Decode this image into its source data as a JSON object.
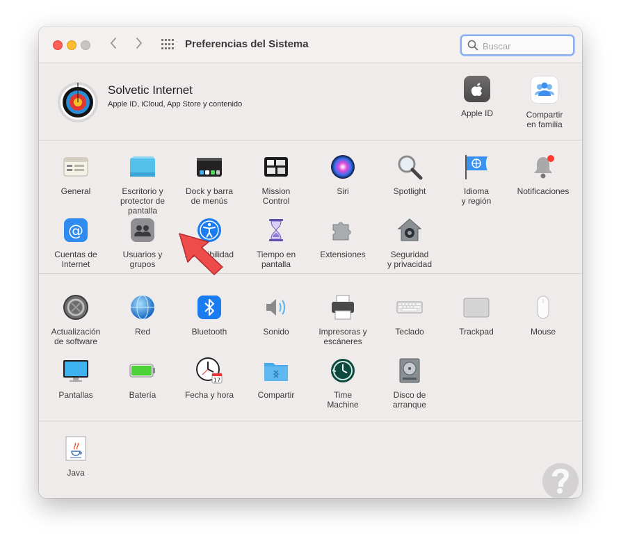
{
  "window": {
    "title": "Preferencias del Sistema"
  },
  "search": {
    "placeholder": "Buscar",
    "value": ""
  },
  "account": {
    "name": "Solvetic Internet",
    "subtitle": "Apple ID, iCloud, App Store y contenido",
    "items": [
      {
        "label": "Apple ID",
        "icon": "apple-id-icon"
      },
      {
        "label": "Compartir\nen familia",
        "icon": "family-sharing-icon"
      }
    ]
  },
  "row1": [
    {
      "label": "General",
      "icon": "general-icon"
    },
    {
      "label": "Escritorio y\nprotector de pantalla",
      "icon": "desktop-screensaver-icon"
    },
    {
      "label": "Dock y barra\nde menús",
      "icon": "dock-menubar-icon"
    },
    {
      "label": "Mission\nControl",
      "icon": "mission-control-icon"
    },
    {
      "label": "Siri",
      "icon": "siri-icon"
    },
    {
      "label": "Spotlight",
      "icon": "spotlight-icon"
    },
    {
      "label": "Idioma\ny región",
      "icon": "language-region-icon"
    },
    {
      "label": "Notificaciones",
      "icon": "notifications-icon"
    }
  ],
  "row2": [
    {
      "label": "Cuentas de\nInternet",
      "icon": "internet-accounts-icon"
    },
    {
      "label": "Usuarios y\ngrupos",
      "icon": "users-groups-icon"
    },
    {
      "label": "Accesibilidad",
      "icon": "accessibility-icon"
    },
    {
      "label": "Tiempo en\npantalla",
      "icon": "screen-time-icon"
    },
    {
      "label": "Extensiones",
      "icon": "extensions-icon"
    },
    {
      "label": "Seguridad\ny privacidad",
      "icon": "security-privacy-icon"
    }
  ],
  "row3": [
    {
      "label": "Actualización\nde software",
      "icon": "software-update-icon"
    },
    {
      "label": "Red",
      "icon": "network-icon"
    },
    {
      "label": "Bluetooth",
      "icon": "bluetooth-icon"
    },
    {
      "label": "Sonido",
      "icon": "sound-icon"
    },
    {
      "label": "Impresoras y\nescáneres",
      "icon": "printers-scanners-icon"
    },
    {
      "label": "Teclado",
      "icon": "keyboard-icon"
    },
    {
      "label": "Trackpad",
      "icon": "trackpad-icon"
    },
    {
      "label": "Mouse",
      "icon": "mouse-icon"
    }
  ],
  "row4": [
    {
      "label": "Pantallas",
      "icon": "displays-icon"
    },
    {
      "label": "Batería",
      "icon": "battery-icon"
    },
    {
      "label": "Fecha y hora",
      "icon": "date-time-icon",
      "calendar_day": "17"
    },
    {
      "label": "Compartir",
      "icon": "sharing-icon"
    },
    {
      "label": "Time\nMachine",
      "icon": "time-machine-icon"
    },
    {
      "label": "Disco de\narranque",
      "icon": "startup-disk-icon"
    }
  ],
  "row5": [
    {
      "label": "Java",
      "icon": "java-icon"
    }
  ]
}
